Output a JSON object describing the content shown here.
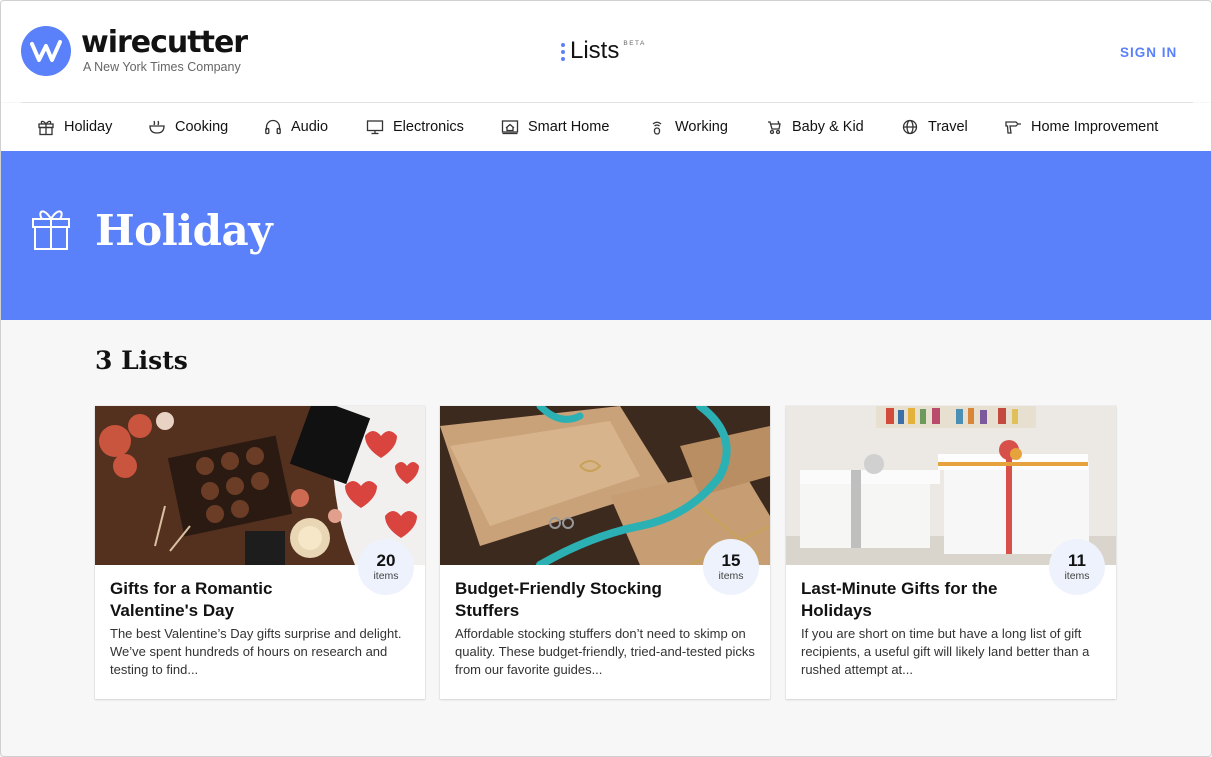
{
  "header": {
    "logo_word": "wirecutter",
    "logo_sub": "A New York Times Company",
    "lists_label": "Lists",
    "lists_beta": "BETA",
    "sign_in": "SIGN IN",
    "accent_color": "#5a81fa"
  },
  "nav": {
    "items": [
      {
        "label": "Holiday",
        "icon": "gift-icon"
      },
      {
        "label": "Cooking",
        "icon": "cooking-icon"
      },
      {
        "label": "Audio",
        "icon": "headphones-icon"
      },
      {
        "label": "Electronics",
        "icon": "monitor-icon"
      },
      {
        "label": "Smart Home",
        "icon": "smart-home-icon"
      },
      {
        "label": "Working",
        "icon": "working-icon"
      },
      {
        "label": "Baby & Kid",
        "icon": "stroller-icon"
      },
      {
        "label": "Travel",
        "icon": "globe-icon"
      },
      {
        "label": "Home Improvement",
        "icon": "drill-icon"
      }
    ]
  },
  "hero": {
    "title": "Holiday",
    "icon": "gift-icon",
    "background": "#5a81fa"
  },
  "main": {
    "count_label": "3 Lists",
    "cards": [
      {
        "title": "Gifts for a Romantic Valentine's Day",
        "description": "The best Valentine’s Day gifts surprise and delight. We’ve spent hundreds of hours on research and testing to find...",
        "count": "20",
        "count_label": "items",
        "image": "valentine-chocolates-image"
      },
      {
        "title": "Budget-Friendly Stocking Stuffers",
        "description": "Affordable stocking stuffers don’t need to skimp on quality. These budget-friendly, tried-and-tested picks from our favorite guides...",
        "count": "15",
        "count_label": "items",
        "image": "kraft-paper-gifts-image"
      },
      {
        "title": "Last-Minute Gifts for the Holidays",
        "description": "If you are short on time but have a long list of gift recipients, a useful gift will likely land better than a rushed attempt at...",
        "count": "11",
        "count_label": "items",
        "image": "white-gift-boxes-image"
      }
    ]
  }
}
